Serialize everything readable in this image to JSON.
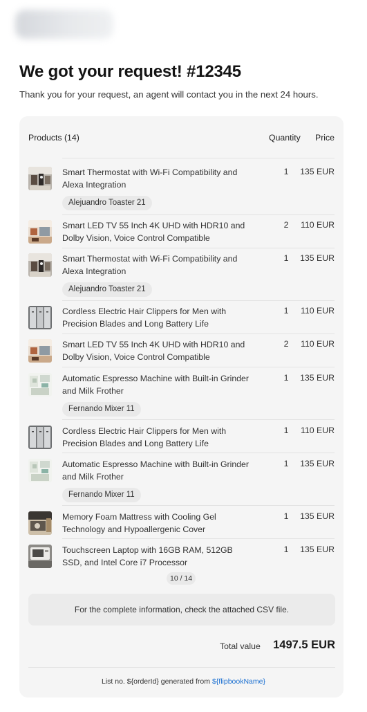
{
  "header": {
    "title": "We got your request! #12345",
    "subtitle": "Thank you for your request, an agent will contact you in the next 24 hours."
  },
  "table": {
    "products_header": "Products (14)",
    "quantity_header": "Quantity",
    "price_header": "Price"
  },
  "items": [
    {
      "name": "Smart Thermostat with Wi-Fi Compatibility and Alexa Integration",
      "qty": "1",
      "price": "135 EUR",
      "tag": "Alejuandro Toaster 21",
      "thumb": "kitchen-icon"
    },
    {
      "name": "Smart LED TV 55 Inch 4K UHD with HDR10 and Dolby Vision, Voice Control Compatible",
      "qty": "2",
      "price": "110 EUR",
      "tag": "",
      "thumb": "room-icon"
    },
    {
      "name": "Smart Thermostat with Wi-Fi Compatibility and Alexa Integration",
      "qty": "1",
      "price": "135 EUR",
      "tag": "Alejuandro Toaster 21",
      "thumb": "kitchen-icon"
    },
    {
      "name": "Cordless Electric Hair Clippers for Men with Precision Blades and Long Battery Life",
      "qty": "1",
      "price": "110 EUR",
      "tag": "",
      "thumb": "cabinet-icon"
    },
    {
      "name": "Smart LED TV 55 Inch 4K UHD with HDR10 and Dolby Vision, Voice Control Compatible",
      "qty": "2",
      "price": "110 EUR",
      "tag": "",
      "thumb": "room-icon"
    },
    {
      "name": "Automatic Espresso Machine with Built-in Grinder and Milk Frother",
      "qty": "1",
      "price": "135 EUR",
      "tag": "Fernando Mixer 11",
      "thumb": "bright-kitchen-icon"
    },
    {
      "name": "Cordless Electric Hair Clippers for Men with Precision Blades and Long Battery Life",
      "qty": "1",
      "price": "110 EUR",
      "tag": "",
      "thumb": "cabinet-icon"
    },
    {
      "name": "Automatic Espresso Machine with Built-in Grinder and Milk Frother",
      "qty": "1",
      "price": "135 EUR",
      "tag": "Fernando Mixer 11",
      "thumb": "bright-kitchen-icon"
    },
    {
      "name": "Memory Foam Mattress with Cooling Gel Technology and Hypoallergenic Cover",
      "qty": "1",
      "price": "135 EUR",
      "tag": "",
      "thumb": "machine-icon"
    },
    {
      "name": "Touchscreen Laptop with 16GB RAM, 512GB SSD, and Intel Core i7 Processor",
      "qty": "1",
      "price": "135 EUR",
      "tag": "",
      "thumb": "appliance-icon"
    }
  ],
  "pagination": "10 / 14",
  "notice": "For the complete information, check the attached CSV file.",
  "summary": {
    "total_label": "Total value",
    "total_value": "1497.5 EUR"
  },
  "footer": {
    "prefix": "List no. ${orderId} generated from ",
    "link": "${flipbookName}"
  }
}
